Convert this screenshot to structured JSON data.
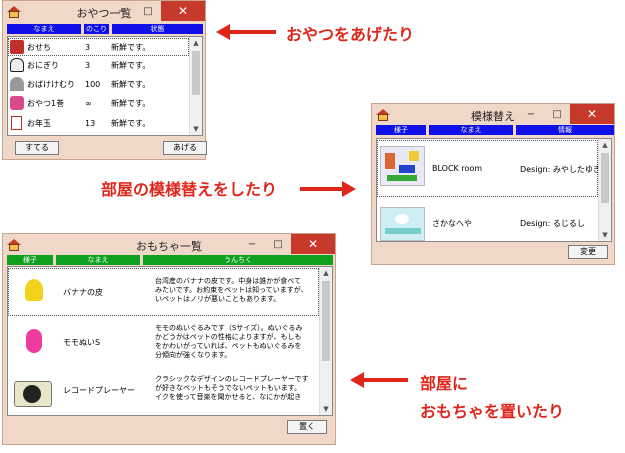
{
  "snacks": {
    "title": "おやつ一覧",
    "columns": [
      "なまえ",
      "のこり",
      "状態"
    ],
    "rows": [
      {
        "name": "おせち",
        "left": "3",
        "status": "新鮮です。"
      },
      {
        "name": "おにぎり",
        "left": "3",
        "status": "新鮮です。"
      },
      {
        "name": "おばけけむり",
        "left": "100",
        "status": "新鮮です。"
      },
      {
        "name": "おやつ1巻",
        "left": "∞",
        "status": "新鮮です。"
      },
      {
        "name": "お年玉",
        "left": "13",
        "status": "新鮮です。"
      }
    ],
    "discard_button": "すてる",
    "give_button": "あげる"
  },
  "pattern": {
    "title": "模様替え",
    "columns": [
      "様子",
      "なまえ",
      "情報"
    ],
    "rows": [
      {
        "name": "BLOCK room",
        "info": "Design: みやしたゆきこ"
      },
      {
        "name": "さかなへや",
        "info": "Design: るじるし"
      }
    ],
    "change_button": "変更"
  },
  "toys": {
    "title": "おもちゃ一覧",
    "columns": [
      "様子",
      "なまえ",
      "うんちく"
    ],
    "rows": [
      {
        "name": "バナナの皮",
        "desc": "台湾産のバナナの皮です。中身は誰かが食べて\nみたいです。お約束をペットは知っていますが、\nいペットはノリが悪いこともあります。"
      },
      {
        "name": "モモぬいS",
        "desc": "モモのぬいぐるみです（Sサイズ）。ぬいぐるみ\nかどうかはペットの性格によりますが、もしも\nをかわいがっていれば、ペットもぬいぐるみを\n分傾向が強くなります。"
      },
      {
        "name": "レコードプレーヤー",
        "desc": "クラシックなデザインのレコードプレーヤーです\nが好きなペットもそうでないペットもいます。\nイクを使って音楽を聞かせると、なにかが起き"
      }
    ],
    "place_button": "置く"
  },
  "captions": {
    "snacks": "おやつをあげたり",
    "pattern": "部屋の模様替えをしたり",
    "toys_line1": "部屋に",
    "toys_line2": "おもちゃを置いたり"
  },
  "window_controls": {
    "minimize": "−",
    "maximize": "□",
    "close": "✕"
  },
  "scroll_arrows": {
    "up": "▲",
    "down": "▼"
  },
  "colors": {
    "arrow": "#e0261b",
    "header_blue": "#1010e8",
    "header_green": "#10a020",
    "window_bg": "#f0d8c8",
    "close": "#c7392b"
  }
}
